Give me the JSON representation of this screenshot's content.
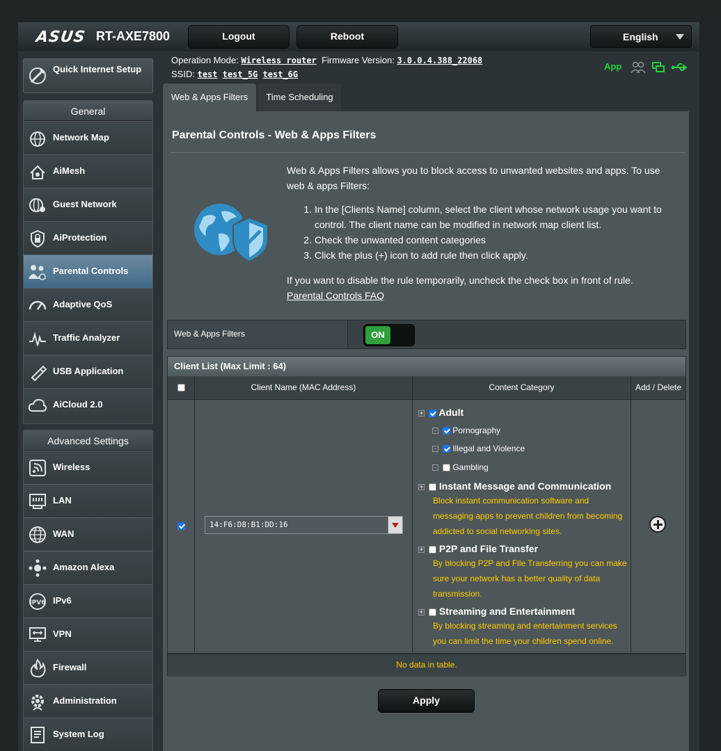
{
  "header": {
    "brand": "ASUS",
    "model": "RT-AXE7800",
    "logout_label": "Logout",
    "reboot_label": "Reboot",
    "language": "English"
  },
  "info": {
    "operation_mode_label": "Operation Mode:",
    "operation_mode": "Wireless router",
    "firmware_label": "Firmware Version:",
    "firmware": "3.0.0.4.388_22068",
    "ssid_label": "SSID:",
    "ssids": [
      "test",
      "test_5G",
      "test_6G"
    ],
    "app_label": "App"
  },
  "sidebar": {
    "qis_label": "Quick Internet Setup",
    "general_header": "General",
    "general_items": [
      {
        "label": "Network Map",
        "icon": "globe-icon"
      },
      {
        "label": "AiMesh",
        "icon": "mesh-icon"
      },
      {
        "label": "Guest Network",
        "icon": "guest-globe-icon"
      },
      {
        "label": "AiProtection",
        "icon": "lock-shield-icon"
      },
      {
        "label": "Parental Controls",
        "icon": "family-icon",
        "active": true
      },
      {
        "label": "Adaptive QoS",
        "icon": "speedometer-icon"
      },
      {
        "label": "Traffic Analyzer",
        "icon": "pulse-icon"
      },
      {
        "label": "USB Application",
        "icon": "usb-icon"
      },
      {
        "label": "AiCloud 2.0",
        "icon": "cloud-icon"
      }
    ],
    "advanced_header": "Advanced Settings",
    "advanced_items": [
      {
        "label": "Wireless",
        "icon": "wifi-icon"
      },
      {
        "label": "LAN",
        "icon": "lan-icon"
      },
      {
        "label": "WAN",
        "icon": "wan-globe-icon"
      },
      {
        "label": "Amazon Alexa",
        "icon": "alexa-icon"
      },
      {
        "label": "IPv6",
        "icon": "ipv6-icon"
      },
      {
        "label": "VPN",
        "icon": "vpn-icon"
      },
      {
        "label": "Firewall",
        "icon": "fire-icon"
      },
      {
        "label": "Administration",
        "icon": "admin-gear-icon"
      },
      {
        "label": "System Log",
        "icon": "log-icon"
      }
    ]
  },
  "tabs": [
    "Web & Apps Filters",
    "Time Scheduling"
  ],
  "main": {
    "title": "Parental Controls - Web & Apps Filters",
    "intro": "Web & Apps Filters allows you to block access to unwanted websites and apps. To use web & apps Filters:",
    "steps": [
      "In the [Clients Name] column, select the client whose network usage you want to control. The client name can be modified in network map client list.",
      "Check the unwanted content categories",
      "Click the plus (+) icon to add rule then click apply."
    ],
    "disable_note": "If you want to disable the rule temporarily, uncheck the check box in front of rule.",
    "faq_link": "Parental Controls FAQ",
    "toggle_label": "Web & Apps Filters",
    "toggle_state": "ON",
    "client_list_header": "Client List (Max Limit : 64)",
    "col_name": "Client Name (MAC Address)",
    "col_category": "Content Category",
    "col_add": "Add / Delete",
    "mac_value": "14:F6:D8:B1:DD:16",
    "categories": {
      "adult": "Adult",
      "porn": "Pornography",
      "illegal": "Illegal and Violence",
      "gambling": "Gambling",
      "im": "Instant Message and Communication",
      "im_note": "Block instant communication software and messaging apps to prevent children from becoming addicted to social networking sites.",
      "p2p": "P2P and File Transfer",
      "p2p_note": "By blocking P2P and File Transferring you can make sure your network has a better quality of data transmission.",
      "stream": "Streaming and Entertainment",
      "stream_note": "By blocking streaming and entertainment services you can limit the time your children spend online."
    },
    "no_data": "No data in table.",
    "apply_label": "Apply"
  }
}
